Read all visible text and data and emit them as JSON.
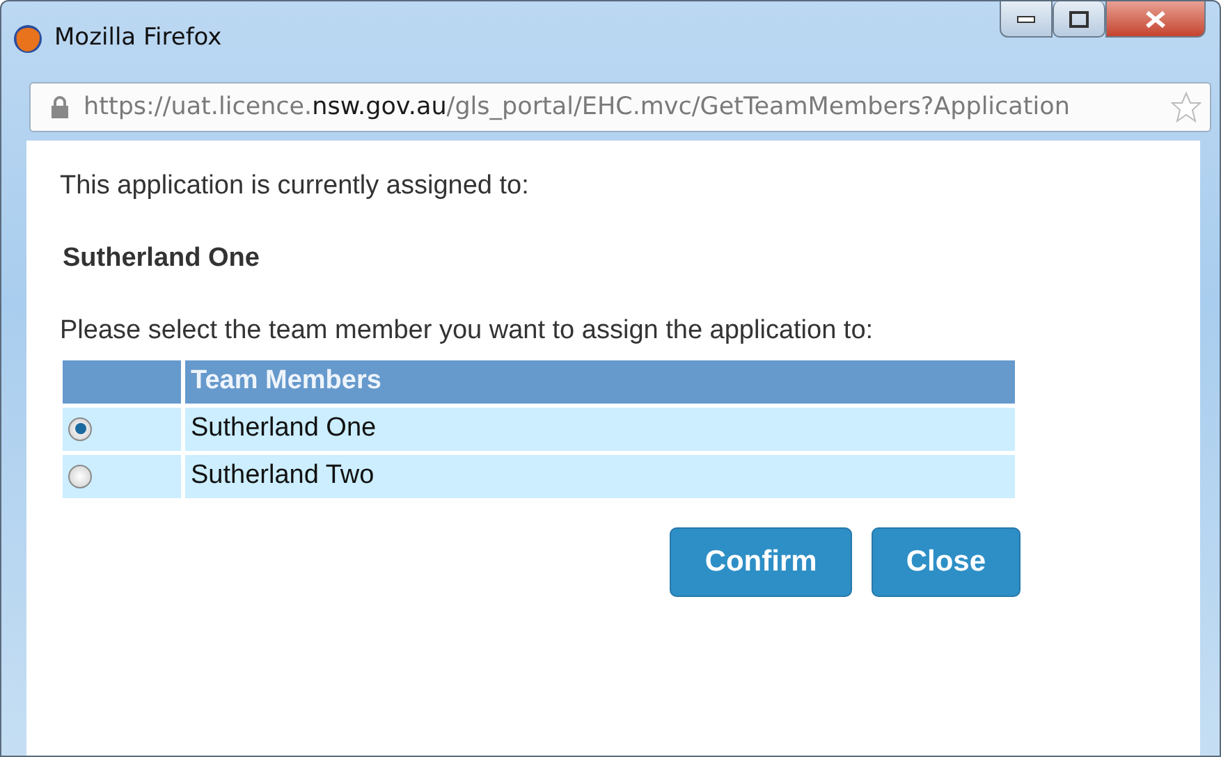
{
  "window": {
    "title": "Mozilla Firefox"
  },
  "address_bar": {
    "url": "https://uat.licence.**nsw.gov.au**/gls_portal/EHC.mvc/GetTeamMembers?Application"
  },
  "intro": "This application is currently assigned to:",
  "current_assignee": "Sutherland One",
  "prompt": "Please select the team member you want to assign the application to:",
  "table": {
    "columns": [
      "Team Members"
    ],
    "rows": [
      {
        "name": "Sutherland One",
        "selected": true
      },
      {
        "name": "Sutherland Two",
        "selected": false
      }
    ]
  },
  "buttons": [
    "Confirm",
    "Close"
  ]
}
